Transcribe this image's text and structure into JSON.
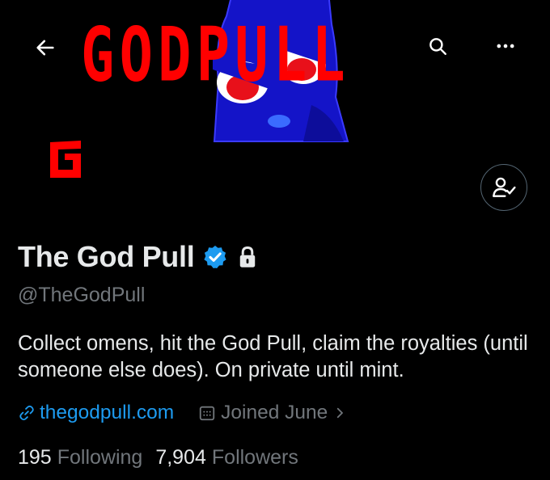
{
  "banner": {
    "title": "GODPULL",
    "accent_color": "#ff0000"
  },
  "topbar": {
    "back_icon": "back-arrow-icon",
    "search_icon": "search-icon",
    "more_icon": "more-dots-icon"
  },
  "avatar": {
    "logo_letter": "G",
    "color": "#ff0000"
  },
  "follow_button": {
    "icon": "follow-user-icon"
  },
  "profile": {
    "display_name": "The God Pull",
    "verified_icon": "verified-badge-icon",
    "protected_icon": "lock-icon",
    "handle": "@TheGodPull",
    "bio": "Collect omens, hit the God Pull, claim the royalties (until someone else does). On private until mint.",
    "website": "thegodpull.com",
    "joined": "Joined June",
    "link_color": "#1d9bf0",
    "verified_color": "#1d9bf0"
  },
  "stats": {
    "following_count": "195",
    "following_label": "Following",
    "followers_count": "7,904",
    "followers_label": "Followers"
  }
}
